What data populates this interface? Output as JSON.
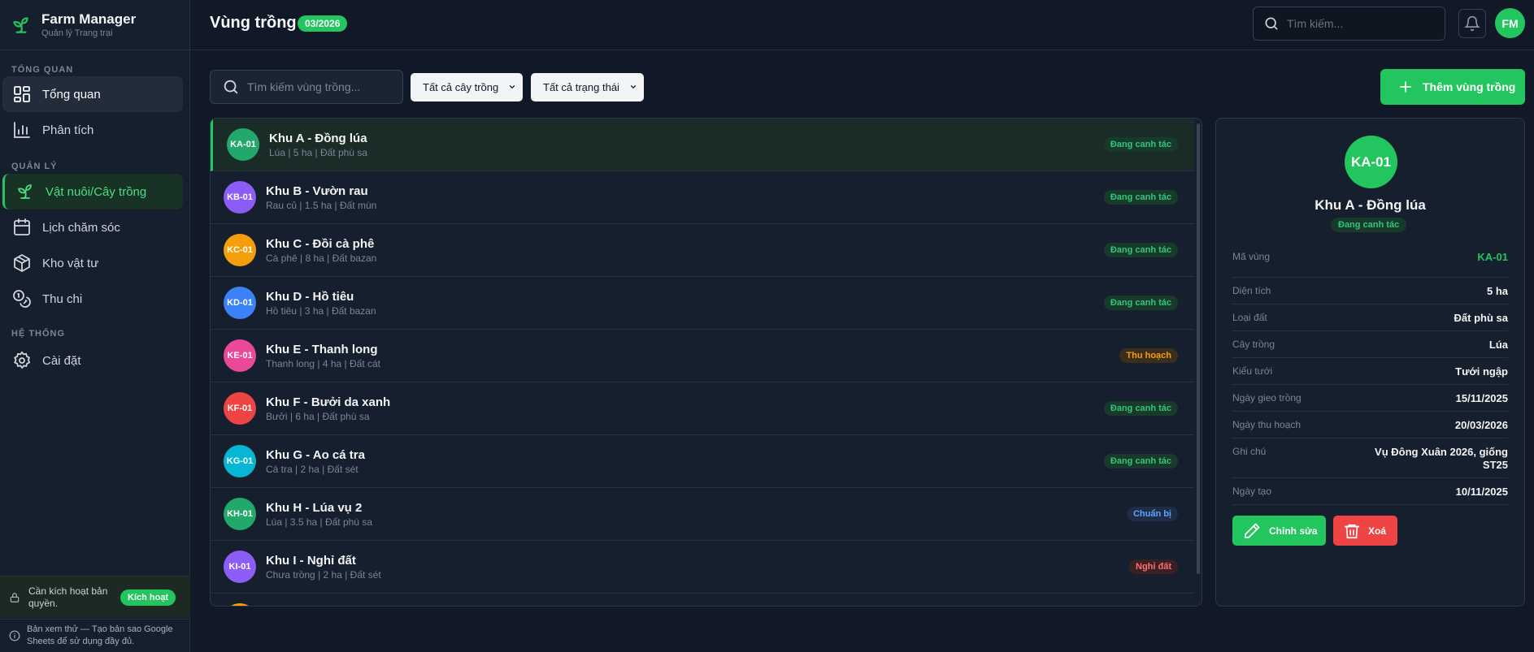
{
  "app": {
    "title": "Farm Manager",
    "subtitle": "Quản lý Trang trại"
  },
  "sidebar": {
    "sections": [
      {
        "label": "TỔNG QUAN"
      },
      {
        "label": "QUẢN LÝ"
      },
      {
        "label": "HỆ THỐNG"
      }
    ],
    "items": [
      {
        "label": "Tổng quan",
        "icon": "dashboard-icon"
      },
      {
        "label": "Phân tích",
        "icon": "bar-chart-icon"
      },
      {
        "label": "Vật nuôi/Cây trồng",
        "icon": "sprout-icon"
      },
      {
        "label": "Lịch chăm sóc",
        "icon": "calendar-icon"
      },
      {
        "label": "Kho vật tư",
        "icon": "box-icon"
      },
      {
        "label": "Thu chi",
        "icon": "coins-icon"
      },
      {
        "label": "Cài đặt",
        "icon": "gear-icon"
      }
    ],
    "license": {
      "text": "Cần kích hoạt bản quyền.",
      "button": "Kích hoạt"
    },
    "trial": {
      "text": "Bản xem thử — Tạo bản sao Google Sheets để sử dụng đầy đủ."
    }
  },
  "header": {
    "title": "Vùng trồng",
    "period": "03/2026",
    "search_placeholder": "Tìm kiếm...",
    "avatar": "FM"
  },
  "toolbar": {
    "search_placeholder": "Tìm kiếm vùng trồng...",
    "crop_filter": "Tất cả cây trồng",
    "status_filter": "Tất cả trạng thái",
    "add_button": "Thêm vùng trồng"
  },
  "colors": {
    "accent": "#22c55e",
    "background": "#111827",
    "danger": "#ef4444"
  },
  "zones": [
    {
      "code": "KA-01",
      "name": "Khu A - Đồng lúa",
      "info": "Lúa | 5 ha | Đất phù sa",
      "status": "Đang canh tác",
      "color": "#22a86a",
      "tone": "green"
    },
    {
      "code": "KB-01",
      "name": "Khu B - Vườn rau",
      "info": "Rau củ | 1.5 ha | Đất mùn",
      "status": "Đang canh tác",
      "color": "#8b5cf6",
      "tone": "green"
    },
    {
      "code": "KC-01",
      "name": "Khu C - Đồi cà phê",
      "info": "Cà phê | 8 ha | Đất bazan",
      "status": "Đang canh tác",
      "color": "#f59e0b",
      "tone": "green"
    },
    {
      "code": "KD-01",
      "name": "Khu D - Hồ tiêu",
      "info": "Hồ tiêu | 3 ha | Đất bazan",
      "status": "Đang canh tác",
      "color": "#3b82f6",
      "tone": "green"
    },
    {
      "code": "KE-01",
      "name": "Khu E - Thanh long",
      "info": "Thanh long | 4 ha | Đất cát",
      "status": "Thu hoạch",
      "color": "#ec4899",
      "tone": "orange"
    },
    {
      "code": "KF-01",
      "name": "Khu F - Bưởi da xanh",
      "info": "Bưởi | 6 ha | Đất phù sa",
      "status": "Đang canh tác",
      "color": "#ef4444",
      "tone": "green"
    },
    {
      "code": "KG-01",
      "name": "Khu G - Ao cá tra",
      "info": "Cá tra | 2 ha | Đất sét",
      "status": "Đang canh tác",
      "color": "#06b6d4",
      "tone": "green"
    },
    {
      "code": "KH-01",
      "name": "Khu H - Lúa vụ 2",
      "info": "Lúa | 3.5 ha | Đất phù sa",
      "status": "Chuẩn bị",
      "color": "#22a86a",
      "tone": "blue"
    },
    {
      "code": "KI-01",
      "name": "Khu I - Nghỉ đất",
      "info": "Chưa trồng | 2 ha | Đất sét",
      "status": "Nghỉ đất",
      "color": "#8b5cf6",
      "tone": "red"
    },
    {
      "code": "",
      "name": "",
      "info": "",
      "status": "",
      "color": "#f59e0b",
      "tone": "green"
    }
  ],
  "detail": {
    "code": "KA-01",
    "name": "Khu A - Đồng lúa",
    "status": "Đang canh tác",
    "fields": [
      {
        "label": "Mã vùng",
        "value": "KA-01"
      },
      {
        "label": "Diện tích",
        "value": "5 ha"
      },
      {
        "label": "Loại đất",
        "value": "Đất phù sa"
      },
      {
        "label": "Cây trồng",
        "value": "Lúa"
      },
      {
        "label": "Kiểu tưới",
        "value": "Tưới ngập"
      },
      {
        "label": "Ngày gieo trồng",
        "value": "15/11/2025"
      },
      {
        "label": "Ngày thu hoạch",
        "value": "20/03/2026"
      },
      {
        "label": "Ghi chú",
        "value": "Vụ Đông Xuân 2026, giống ST25"
      },
      {
        "label": "Ngày tạo",
        "value": "10/11/2025"
      }
    ],
    "edit_button": "Chỉnh sửa",
    "delete_button": "Xoá"
  }
}
